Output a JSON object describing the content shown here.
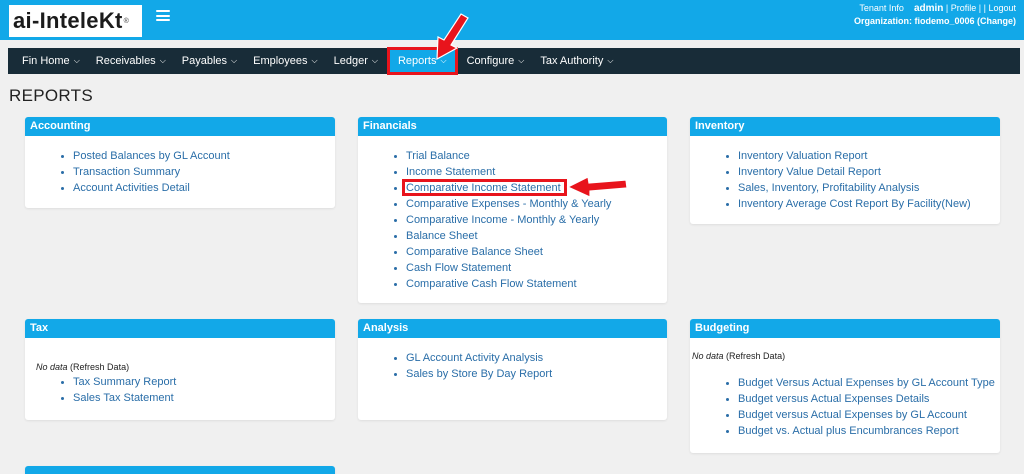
{
  "header": {
    "logo_text": "ai-InteleKt",
    "logo_reg": "®",
    "tenant_info": "Tenant Info",
    "user": "admin",
    "profile": "Profile",
    "logout": "Logout",
    "org_label": "Organization:",
    "org_value": "fiodemo_0006",
    "change": "Change"
  },
  "nav": [
    {
      "label": "Fin Home"
    },
    {
      "label": "Receivables"
    },
    {
      "label": "Payables"
    },
    {
      "label": "Employees"
    },
    {
      "label": "Ledger"
    },
    {
      "label": "Reports"
    },
    {
      "label": "Configure"
    },
    {
      "label": "Tax Authority"
    }
  ],
  "page_title": "REPORTS",
  "panels": {
    "accounting": {
      "title": "Accounting",
      "items": [
        "Posted Balances by GL Account",
        "Transaction Summary",
        "Account Activities Detail"
      ]
    },
    "financials": {
      "title": "Financials",
      "items": [
        "Trial Balance",
        "Income Statement",
        "Comparative Income Statement",
        "Comparative Expenses - Monthly & Yearly",
        "Comparative Income - Monthly & Yearly",
        "Balance Sheet",
        "Comparative Balance Sheet",
        "Cash Flow Statement",
        "Comparative Cash Flow Statement"
      ]
    },
    "inventory": {
      "title": "Inventory",
      "items": [
        "Inventory Valuation Report",
        "Inventory Value Detail Report",
        "Sales, Inventory, Profitability Analysis",
        "Inventory Average Cost Report By Facility(New)"
      ]
    },
    "tax": {
      "title": "Tax",
      "no_data": "No data",
      "refresh": "(Refresh Data)",
      "items": [
        "Tax Summary Report",
        "Sales Tax Statement"
      ]
    },
    "analysis": {
      "title": "Analysis",
      "items": [
        "GL Account Activity Analysis",
        "Sales by Store By Day Report"
      ]
    },
    "budgeting": {
      "title": "Budgeting",
      "no_data": "No data",
      "refresh": "(Refresh Data)",
      "items": [
        "Budget Versus Actual Expenses by GL Account Type",
        "Budget versus Actual Expenses Details",
        "Budget versus Actual Expenses by GL Account",
        "Budget vs. Actual plus Encumbrances Report"
      ]
    }
  },
  "colors": {
    "brand": "#12a8e8",
    "nav_bg": "#182c38",
    "highlight": "#e8141c",
    "link": "#2a6ea8"
  }
}
